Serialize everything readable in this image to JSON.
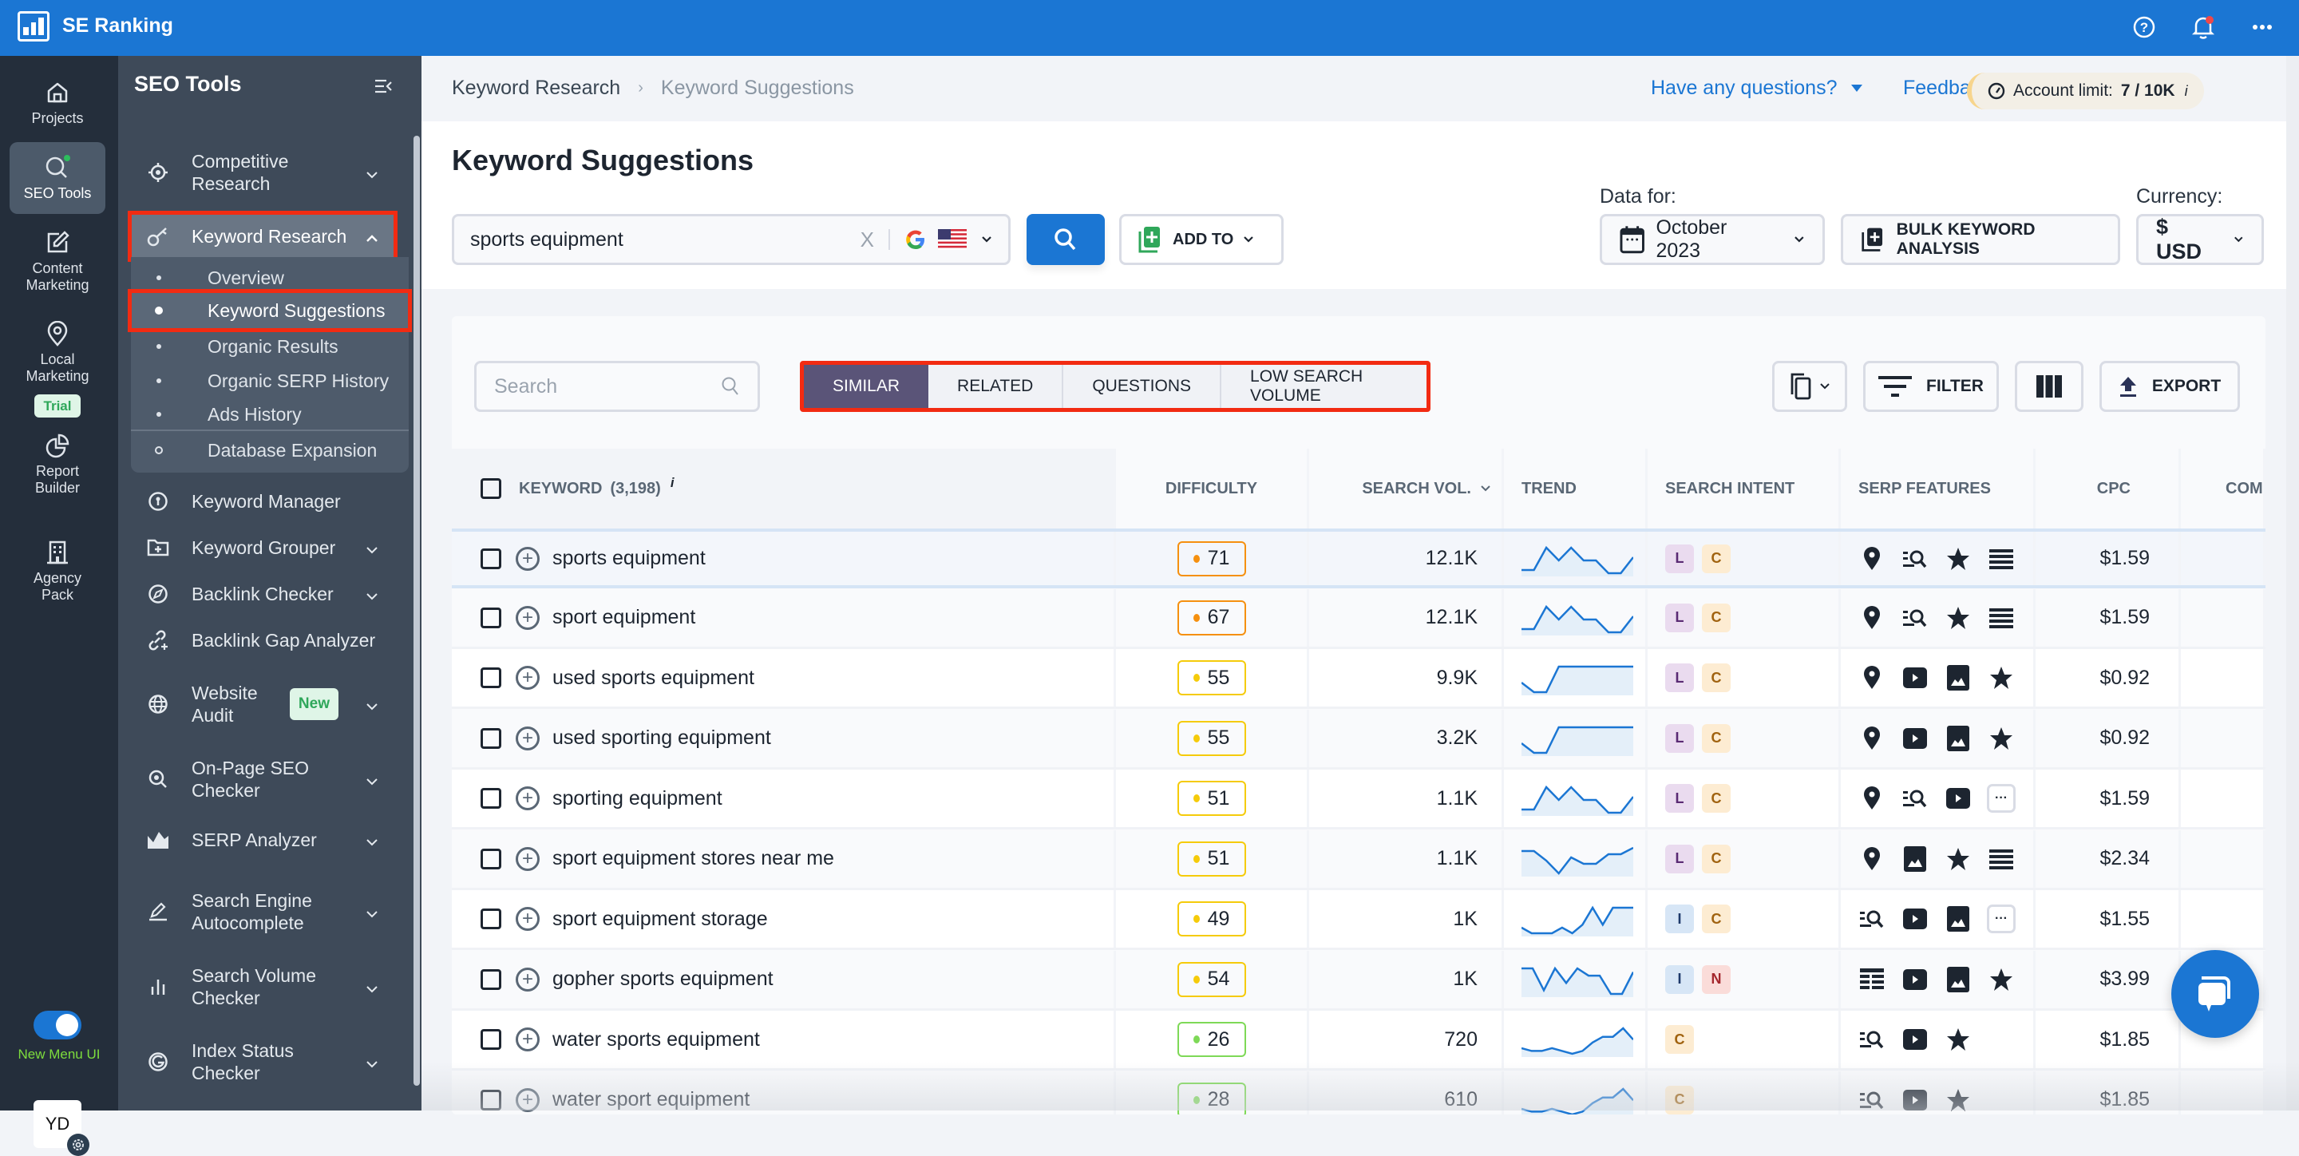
{
  "app": {
    "title": "SE Ranking"
  },
  "topbar": {
    "icons": [
      "help-icon",
      "bell-icon",
      "more-icon"
    ],
    "notification_dot": true
  },
  "rail": {
    "items": [
      {
        "label": "Projects",
        "icon": "home-icon"
      },
      {
        "label": "SEO Tools",
        "icon": "search-icon",
        "active": true
      },
      {
        "label": "Content Marketing",
        "icon": "edit-icon"
      },
      {
        "label": "Local Marketing",
        "icon": "map-pin-icon",
        "badge": "Trial"
      },
      {
        "label": "Report Builder",
        "icon": "pie-chart-icon"
      },
      {
        "label": "Agency Pack",
        "icon": "building-icon"
      }
    ],
    "toggle_label": "New Menu UI",
    "toggle_on": true,
    "avatar": "YD"
  },
  "sidebar": {
    "title": "SEO Tools",
    "items": [
      {
        "label": "Competitive Research",
        "icon": "target-icon",
        "chevron": "down"
      },
      {
        "label": "Keyword Research",
        "icon": "key-icon",
        "chevron": "up",
        "open": true
      },
      {
        "label": "Keyword Manager",
        "icon": "keyword-manager-icon"
      },
      {
        "label": "Keyword Grouper",
        "icon": "folder-plus-icon",
        "chevron": "down"
      },
      {
        "label": "Backlink Checker",
        "icon": "compass-icon",
        "chevron": "down"
      },
      {
        "label": "Backlink Gap Analyzer",
        "icon": "link-plus-icon"
      },
      {
        "label": "Website Audit",
        "icon": "globe-icon",
        "chevron": "down",
        "badge": "New"
      },
      {
        "label": "On-Page SEO Checker",
        "icon": "magnifier-icon",
        "chevron": "down"
      },
      {
        "label": "SERP Analyzer",
        "icon": "mountain-chart-icon",
        "chevron": "down"
      },
      {
        "label": "Search Engine Autocomplete",
        "icon": "pen-icon",
        "chevron": "down"
      },
      {
        "label": "Search Volume Checker",
        "icon": "bars-icon",
        "chevron": "down"
      },
      {
        "label": "Index Status Checker",
        "icon": "google-icon",
        "chevron": "down"
      }
    ],
    "subitems": [
      {
        "label": "Overview"
      },
      {
        "label": "Keyword Suggestions",
        "current": true
      },
      {
        "label": "Organic Results"
      },
      {
        "label": "Organic SERP History"
      },
      {
        "label": "Ads History"
      },
      {
        "label": "Database Expansion",
        "ring": true
      }
    ]
  },
  "header": {
    "breadcrumb": [
      "Keyword Research",
      "Keyword Suggestions"
    ],
    "help_label": "Have any questions?",
    "feedback_label": "Feedback",
    "account_limit_label": "Account limit:",
    "account_limit_value": "7 / 10K",
    "info_mark": "i"
  },
  "page": {
    "title": "Keyword Suggestions",
    "keyword_value": "sports equipment",
    "clear_mark": "X",
    "add_to_label": "ADD TO",
    "data_for_label": "Data for:",
    "date_value": "October 2023",
    "bulk_label": "BULK KEYWORD ANALYSIS",
    "currency_label": "Currency:",
    "currency_value": "$ USD"
  },
  "table": {
    "search_placeholder": "Search",
    "tabs": [
      {
        "label": "SIMILAR",
        "active": true
      },
      {
        "label": "RELATED"
      },
      {
        "label": "QUESTIONS"
      },
      {
        "label": "LOW SEARCH VOLUME"
      }
    ],
    "filter_label": "FILTER",
    "export_label": "EXPORT",
    "columns": {
      "keyword": "KEYWORD",
      "keyword_count": "(3,198)",
      "difficulty": "DIFFICULTY",
      "search_vol": "SEARCH VOL.",
      "trend": "TREND",
      "intent": "SEARCH INTENT",
      "serp": "SERP FEATURES",
      "cpc": "CPC",
      "com": "COM"
    },
    "colors": {
      "orange": "#f5900f",
      "yellow": "#f5cb0a",
      "green": "#7ed957"
    },
    "rows": [
      {
        "keyword": "sports equipment",
        "difficulty": 71,
        "level": "orange",
        "volume": "12.1K",
        "trend": [
          2,
          2,
          9,
          5,
          9,
          5,
          5,
          1,
          1,
          6
        ],
        "intent": [
          "L",
          "C"
        ],
        "serp": [
          "pin",
          "serp-search",
          "star",
          "list"
        ],
        "cpc": "$1.59"
      },
      {
        "keyword": "sport equipment",
        "difficulty": 67,
        "level": "orange",
        "volume": "12.1K",
        "trend": [
          2,
          2,
          9,
          5,
          9,
          5,
          5,
          1,
          1,
          6
        ],
        "intent": [
          "L",
          "C"
        ],
        "serp": [
          "pin",
          "serp-search",
          "star",
          "list"
        ],
        "cpc": "$1.59"
      },
      {
        "keyword": "used sports equipment",
        "difficulty": 55,
        "level": "yellow",
        "volume": "9.9K",
        "trend": [
          5,
          2,
          2,
          10,
          10,
          10,
          10,
          10,
          10,
          10
        ],
        "intent": [
          "L",
          "C"
        ],
        "serp": [
          "pin",
          "video",
          "image",
          "star"
        ],
        "cpc": "$0.92"
      },
      {
        "keyword": "used sporting equipment",
        "difficulty": 55,
        "level": "yellow",
        "volume": "3.2K",
        "trend": [
          5,
          2,
          2,
          10,
          10,
          10,
          10,
          10,
          10,
          10
        ],
        "intent": [
          "L",
          "C"
        ],
        "serp": [
          "pin",
          "video",
          "image",
          "star"
        ],
        "cpc": "$0.92"
      },
      {
        "keyword": "sporting equipment",
        "difficulty": 51,
        "level": "yellow",
        "volume": "1.1K",
        "trend": [
          2,
          2,
          9,
          5,
          9,
          5,
          5,
          1,
          1,
          6
        ],
        "intent": [
          "L",
          "C"
        ],
        "serp": [
          "pin",
          "serp-search",
          "video",
          "more"
        ],
        "cpc": "$1.59"
      },
      {
        "keyword": "sport equipment stores near me",
        "difficulty": 51,
        "level": "yellow",
        "volume": "1.1K",
        "trend": [
          9,
          9,
          6,
          2,
          7,
          5,
          5,
          8,
          8,
          10
        ],
        "intent": [
          "L",
          "C"
        ],
        "serp": [
          "pin",
          "image",
          "star",
          "list"
        ],
        "cpc": "$2.34"
      },
      {
        "keyword": "sport equipment storage",
        "difficulty": 49,
        "level": "yellow",
        "volume": "1K",
        "trend": [
          3,
          1,
          1,
          1,
          3,
          1,
          4,
          10,
          4,
          10,
          10,
          10
        ],
        "intent": [
          "I",
          "C"
        ],
        "serp": [
          "serp-search",
          "video",
          "image",
          "more"
        ],
        "cpc": "$1.55"
      },
      {
        "keyword": "gopher sports equipment",
        "difficulty": 54,
        "level": "yellow",
        "volume": "1K",
        "trend": [
          9,
          9,
          3,
          9,
          5,
          9,
          7,
          7,
          2,
          2,
          8
        ],
        "intent": [
          "I",
          "N"
        ],
        "serp": [
          "table",
          "video",
          "image",
          "star"
        ],
        "cpc": "$3.99"
      },
      {
        "keyword": "water sports equipment",
        "difficulty": 26,
        "level": "green",
        "volume": "720",
        "trend": [
          3,
          2,
          2,
          3,
          2,
          1,
          2,
          5,
          7,
          7,
          10,
          6
        ],
        "intent": [
          "C"
        ],
        "serp": [
          "serp-search",
          "video",
          "star"
        ],
        "cpc": "$1.85"
      },
      {
        "keyword": "water sport equipment",
        "difficulty": 28,
        "level": "green",
        "volume": "610",
        "trend": [
          3,
          2,
          2,
          3,
          2,
          1,
          2,
          5,
          7,
          7,
          10,
          6
        ],
        "intent": [
          "C"
        ],
        "serp": [
          "serp-search",
          "video",
          "star"
        ],
        "cpc": "$1.85"
      }
    ]
  }
}
